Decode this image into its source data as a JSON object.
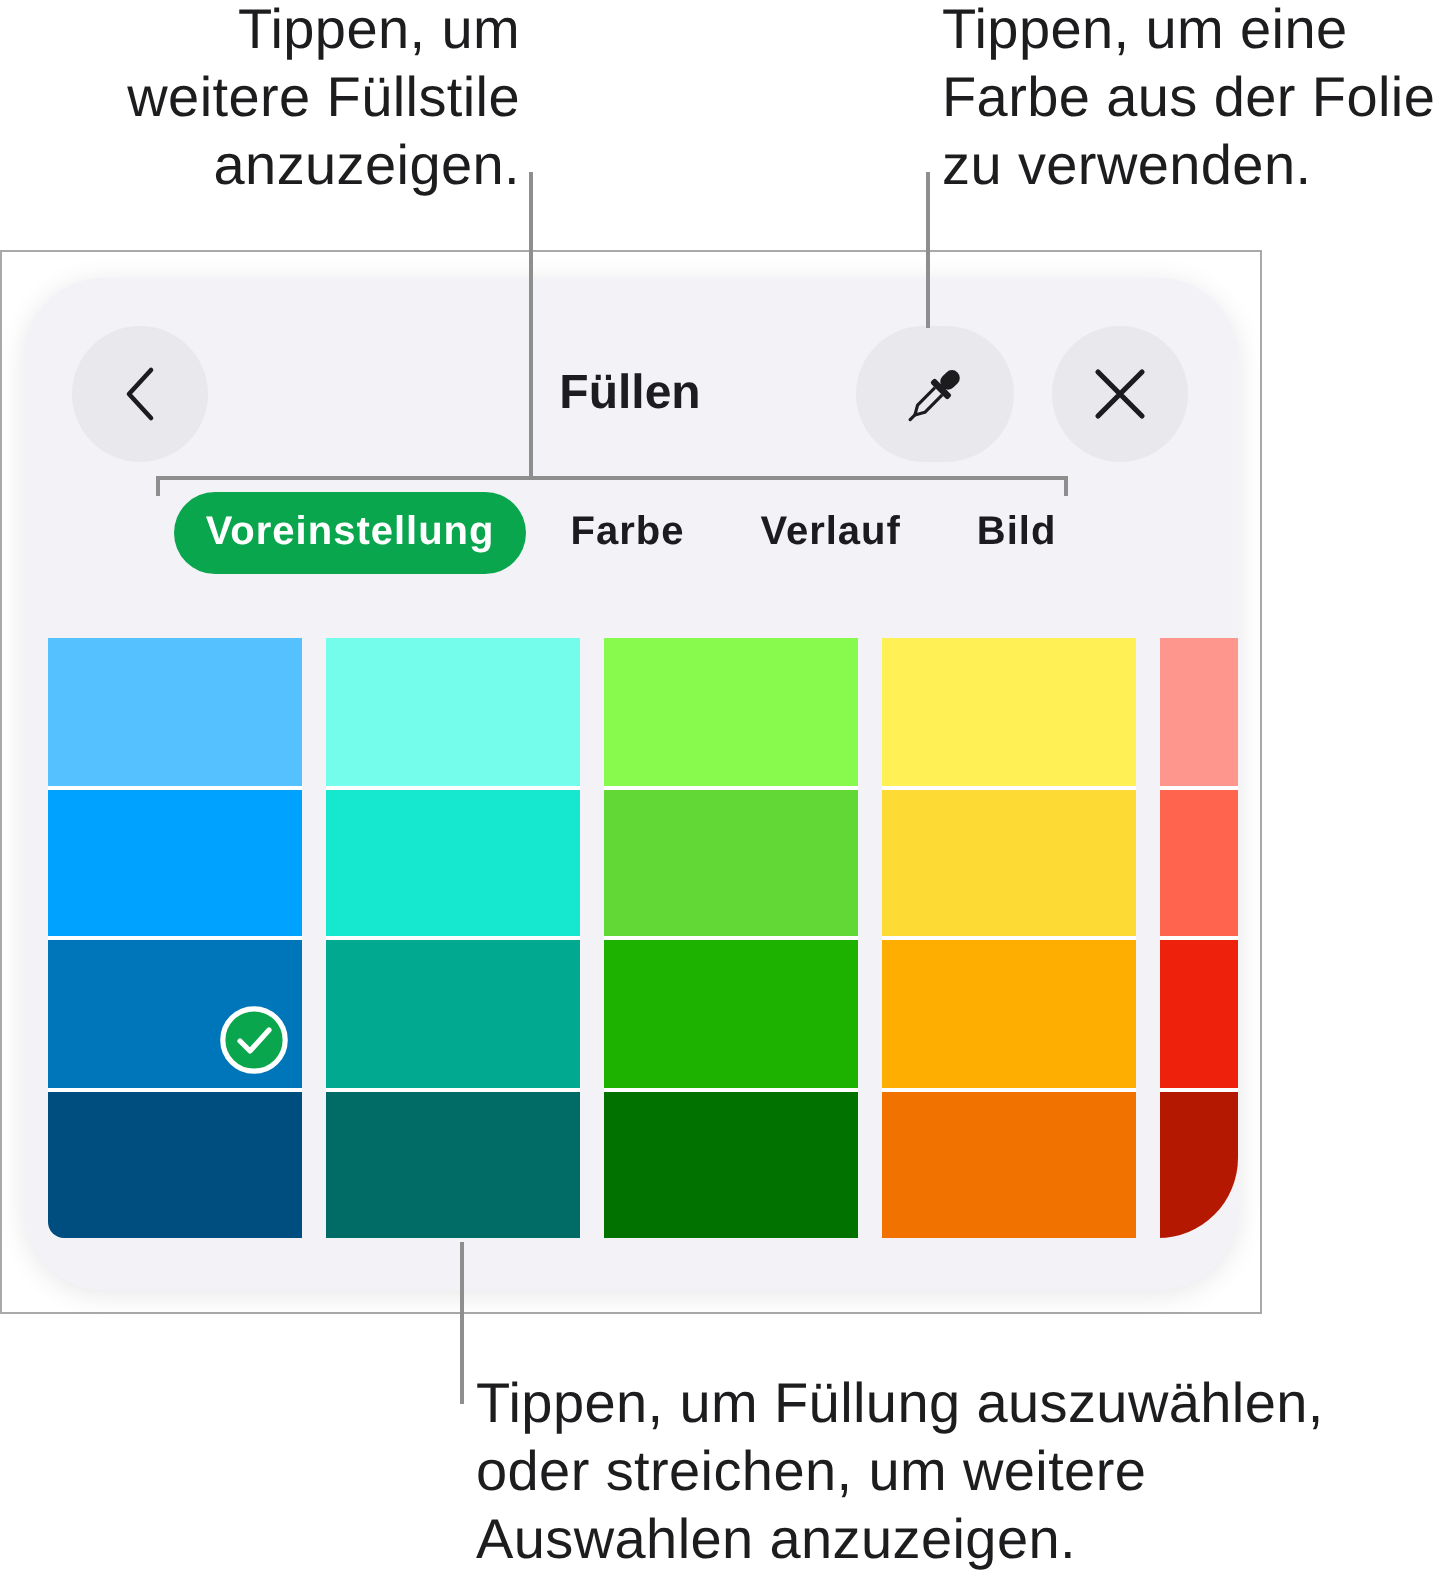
{
  "callouts": {
    "top_left": "Tippen, um\nweitere Füllstile\nanzuzeigen.",
    "top_right": "Tippen, um eine\nFarbe aus der Folie\nzu verwenden.",
    "bottom": "Tippen, um Füllung auszuwählen,\noder streichen, um weitere\nAuswahlen anzuzeigen."
  },
  "panel": {
    "title": "Füllen",
    "tabs": [
      {
        "label": "Voreinstellung",
        "selected": true
      },
      {
        "label": "Farbe",
        "selected": false
      },
      {
        "label": "Verlauf",
        "selected": false
      },
      {
        "label": "Bild",
        "selected": false
      }
    ],
    "swatch_columns": [
      {
        "swatches": [
          {
            "color": "#56c1ff",
            "selected": false
          },
          {
            "color": "#00a2ff",
            "selected": false
          },
          {
            "color": "#0076ba",
            "selected": true
          },
          {
            "color": "#004d80",
            "selected": false
          }
        ]
      },
      {
        "swatches": [
          {
            "color": "#73fdea",
            "selected": false
          },
          {
            "color": "#16e7cf",
            "selected": false
          },
          {
            "color": "#00a98f",
            "selected": false
          },
          {
            "color": "#006c65",
            "selected": false
          }
        ]
      },
      {
        "swatches": [
          {
            "color": "#88fa4e",
            "selected": false
          },
          {
            "color": "#61d836",
            "selected": false
          },
          {
            "color": "#1db100",
            "selected": false
          },
          {
            "color": "#017100",
            "selected": false
          }
        ]
      },
      {
        "swatches": [
          {
            "color": "#fff056",
            "selected": false
          },
          {
            "color": "#feda34",
            "selected": false
          },
          {
            "color": "#feae00",
            "selected": false
          },
          {
            "color": "#f27200",
            "selected": false
          }
        ]
      },
      {
        "swatches": [
          {
            "color": "#ff968d"
          },
          {
            "color": "#ff644e"
          },
          {
            "color": "#ee220c"
          },
          {
            "color": "#b51800"
          }
        ]
      }
    ]
  }
}
